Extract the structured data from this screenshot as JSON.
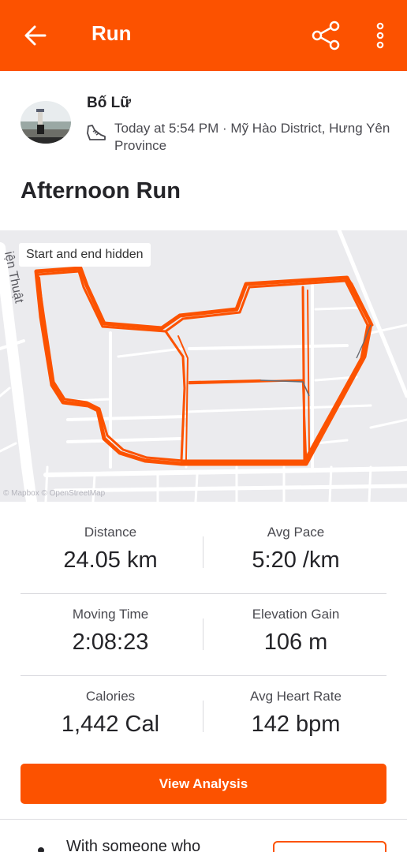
{
  "header": {
    "title": "Run",
    "back_icon": "arrow-left-icon",
    "share_icon": "share-icon",
    "more_icon": "more-vertical-icon",
    "color": "#fc5200"
  },
  "athlete": {
    "name": "Bố Lữ",
    "activity_icon": "shoe-icon",
    "meta": "Today at 5:54 PM · Mỹ Hào District, Hưng Yên Province"
  },
  "activity": {
    "title": "Afternoon Run"
  },
  "map": {
    "privacy_label": "Start and end hidden",
    "street_label": "iện Thuật",
    "attribution": "© Mapbox © OpenStreetMap",
    "route_color": "#fc5200"
  },
  "stats": [
    {
      "label": "Distance",
      "value": "24.05 km"
    },
    {
      "label": "Avg Pace",
      "value": "5:20 /km"
    },
    {
      "label": "Moving Time",
      "value": "2:08:23"
    },
    {
      "label": "Elevation Gain",
      "value": "106 m"
    },
    {
      "label": "Calories",
      "value": "1,442 Cal"
    },
    {
      "label": "Avg Heart Rate",
      "value": "142 bpm"
    }
  ],
  "actions": {
    "view_analysis": "View Analysis"
  },
  "promo": {
    "text": "With someone who"
  }
}
